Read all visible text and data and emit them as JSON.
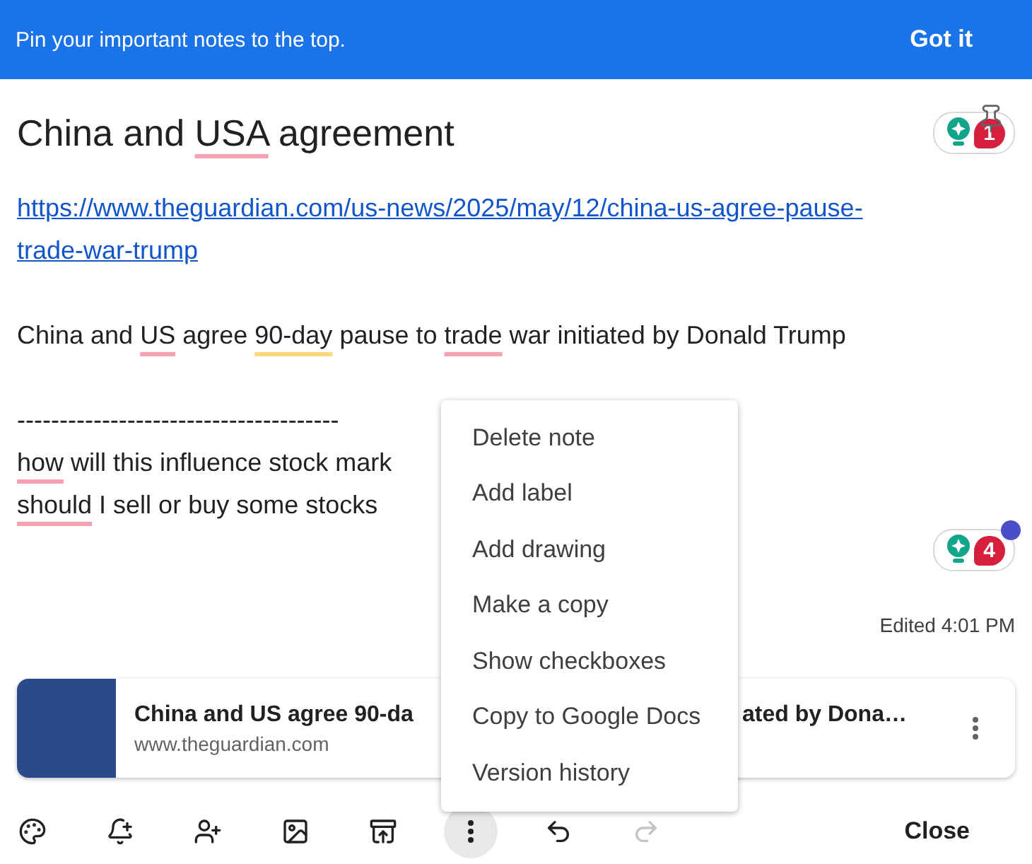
{
  "banner": {
    "message": "Pin your important notes to the top.",
    "action": "Got it"
  },
  "note": {
    "title": [
      {
        "text": "China and ",
        "kind": "plain"
      },
      {
        "text": "USA",
        "kind": "misspelled"
      },
      {
        "text": " agreement",
        "kind": "plain"
      }
    ],
    "title_badge": {
      "count": "1"
    },
    "link": "https://www.theguardian.com/us-news/2025/may/12/china-us-agree-pause-trade-war-trump",
    "lines": [
      [
        {
          "text": "China and ",
          "kind": "plain"
        },
        {
          "text": "US",
          "kind": "misspelled"
        },
        {
          "text": " agree ",
          "kind": "plain"
        },
        {
          "text": "90-day",
          "kind": "grammar"
        },
        {
          "text": " pause to ",
          "kind": "plain"
        },
        {
          "text": "trade",
          "kind": "misspelled"
        },
        {
          "text": " war initiated by Donald Trump",
          "kind": "plain"
        }
      ],
      [
        {
          "text": "--------------------------------------",
          "kind": "plain"
        }
      ],
      [
        {
          "text": "how",
          "kind": "misspelled"
        },
        {
          "text": " will this influence stock mark",
          "kind": "plain"
        }
      ],
      [
        {
          "text": "should",
          "kind": "misspelled"
        },
        {
          "text": " I sell or buy some stocks",
          "kind": "plain"
        }
      ]
    ],
    "body_badge": {
      "count": "4"
    },
    "edited": "Edited 4:01 PM",
    "link_card": {
      "title_parts": [
        "China and US agree 90-da",
        "ated by Dona…"
      ],
      "domain": "www.theguardian.com"
    }
  },
  "menu": [
    "Delete note",
    "Add label",
    "Add drawing",
    "Make a copy",
    "Show checkboxes",
    "Copy to Google Docs",
    "Version history"
  ],
  "toolbar": [
    {
      "kind": "palette",
      "selected": false,
      "disabled": false
    },
    {
      "kind": "reminder",
      "selected": false,
      "disabled": false
    },
    {
      "kind": "collaborator",
      "selected": false,
      "disabled": false
    },
    {
      "kind": "image",
      "selected": false,
      "disabled": false
    },
    {
      "kind": "archive",
      "selected": false,
      "disabled": false
    },
    {
      "kind": "more",
      "selected": true,
      "disabled": false
    },
    {
      "kind": "undo",
      "selected": false,
      "disabled": false
    },
    {
      "kind": "redo",
      "selected": false,
      "disabled": true
    }
  ],
  "close": "Close"
}
